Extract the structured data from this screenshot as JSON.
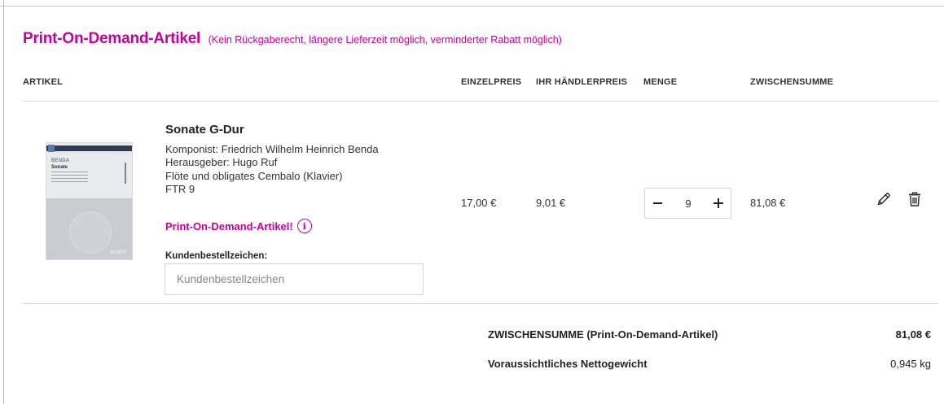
{
  "section": {
    "title": "Print-On-Demand-Artikel",
    "note": "(Kein Rückgaberecht, längere Lieferzeit möglich, verminderter Rabatt möglich)"
  },
  "table_headers": {
    "artikel": "ARTIKEL",
    "einzelpreis": "EINZELPREIS",
    "haendlerpreis": "IHR HÄNDLERPREIS",
    "menge": "MENGE",
    "zwischensumme": "ZWISCHENSUMME"
  },
  "item": {
    "title": "Sonate G-Dur",
    "komponist": "Komponist: Friedrich Wilhelm Heinrich Benda",
    "herausgeber": "Herausgeber: Hugo Ruf",
    "besetzung": "Flöte und obligates Cembalo (Klavier)",
    "bestellnummer": "FTR 9",
    "cover_composer": "BENDA",
    "cover_title": "Sonate",
    "cover_publisher": "SCHOTT",
    "pod_label": "Print-On-Demand-Artikel!",
    "info_icon_glyph": "i",
    "einzelpreis": "17,00 €",
    "haendlerpreis": "9,01 €",
    "quantity": "9",
    "zwischensumme": "81,08 €",
    "reference_label": "Kundenbestellzeichen:",
    "reference_placeholder": "Kundenbestellzeichen",
    "reference_value": ""
  },
  "summary": {
    "subtotal_label": "ZWISCHENSUMME (Print-On-Demand-Artikel)",
    "subtotal_value": "81,08 €",
    "weight_label": "Voraussichtliches Nettogewicht",
    "weight_value": "0,945 kg"
  },
  "icons": {
    "edit": "pencil-icon",
    "delete": "trash-icon",
    "info": "info-icon",
    "decrease": "minus-icon",
    "increase": "plus-icon"
  },
  "colors": {
    "accent": "#c8009a",
    "text": "#222222",
    "divider": "#d8d8d8"
  }
}
